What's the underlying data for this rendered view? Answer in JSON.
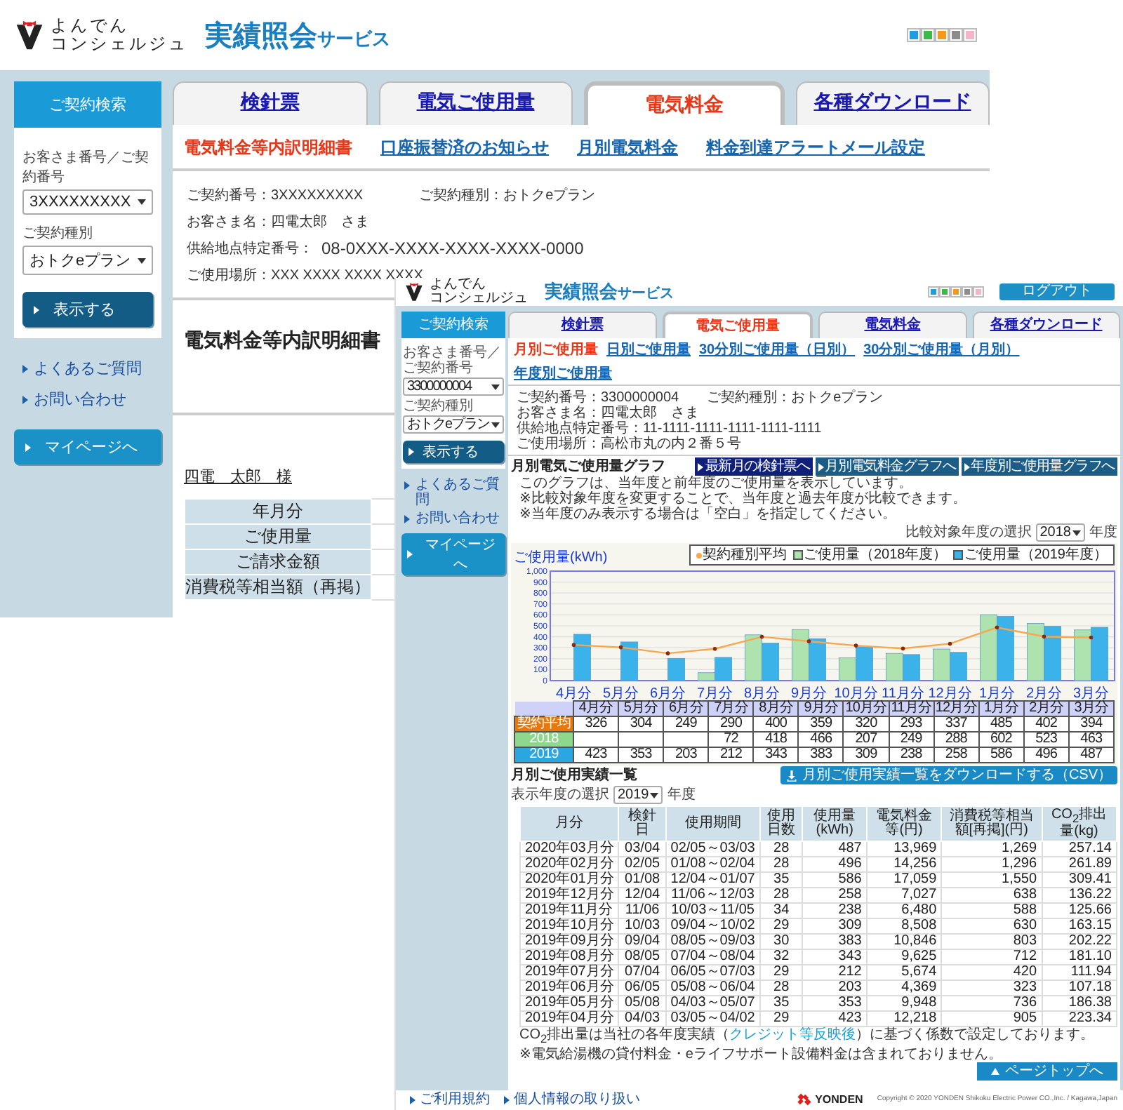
{
  "back_window": {
    "header": {
      "logo_text": [
        "よんでん",
        "コンシェルジュ"
      ],
      "title": "実績照会",
      "title_suffix": "サービス",
      "theme_swatches": [
        {
          "color": "#1e9ee0"
        },
        {
          "color": "#3cb94a"
        },
        {
          "color": "#f39a1e"
        },
        {
          "color": "#8c8c8c"
        },
        {
          "color": "#f5b5c8"
        }
      ]
    },
    "sidebar": {
      "heading": "ご契約検索",
      "fields": [
        {
          "label": "お客さま番号／ご契約番号",
          "value": "3XXXXXXXXX"
        },
        {
          "label": "ご契約種別",
          "value": "おトクeプラン"
        }
      ],
      "submit": "表示する",
      "links": [
        "よくあるご質問",
        "お問い合わせ"
      ],
      "mypage": "マイページへ"
    },
    "tabs": [
      {
        "label": "検針票",
        "selected": false
      },
      {
        "label": "電気ご使用量",
        "selected": false
      },
      {
        "label": "電気料金",
        "selected": true
      },
      {
        "label": "各種ダウンロード",
        "selected": false
      }
    ],
    "subtabs": [
      {
        "label": "電気料金等内訳明細書",
        "selected": true
      },
      {
        "label": "口座振替済のお知らせ",
        "selected": false
      },
      {
        "label": "月別電気料金",
        "selected": false
      },
      {
        "label": "料金到達アラートメール設定",
        "selected": false
      }
    ],
    "contract_info": [
      [
        "ご契約番号：3XXXXXXXXX",
        "ご契約種別：おトクeプラン"
      ],
      [
        "お客さま名：四電太郎　さま"
      ],
      [
        "供給地点特定番号：",
        "08-0XXX-XXXX-XXXX-XXXX-0000"
      ],
      [
        "ご使用場所：XXX XXXX XXXX XXXX"
      ]
    ],
    "page_title": "電気料金等内訳明細書",
    "customer_name": "四電　太郎　様",
    "summary_table": [
      "年月分",
      "ご使用量",
      "ご請求金額",
      "消費税等相当額（再掲）"
    ]
  },
  "front_window": {
    "header": {
      "logo_text": [
        "よんでん",
        "コンシェルジュ"
      ],
      "title": "実績照会",
      "title_suffix": "サービス",
      "theme_swatches": [
        {
          "color": "#1e9ee0"
        },
        {
          "color": "#3cb94a"
        },
        {
          "color": "#f39a1e"
        },
        {
          "color": "#8c8c8c"
        },
        {
          "color": "#f5b5c8"
        }
      ],
      "logout": "ログアウト"
    },
    "sidebar": {
      "heading": "ご契約検索",
      "fields": [
        {
          "label": "お客さま番号／ご契約番号",
          "value": "3300000004"
        },
        {
          "label": "ご契約種別",
          "value": "おトクeプラン"
        }
      ],
      "submit": "表示する",
      "links": [
        "よくあるご質問",
        "お問い合わせ"
      ],
      "mypage": "マイページへ"
    },
    "tabs": [
      {
        "label": "検針票",
        "selected": false
      },
      {
        "label": "電気ご使用量",
        "selected": true
      },
      {
        "label": "電気料金",
        "selected": false
      },
      {
        "label": "各種ダウンロード",
        "selected": false
      }
    ],
    "subtabs": [
      {
        "label": "月別ご使用量",
        "selected": true
      },
      {
        "label": "日別ご使用量",
        "selected": false
      },
      {
        "label": "30分別ご使用量（日別）",
        "selected": false
      },
      {
        "label": "30分別ご使用量（月別）",
        "selected": false
      },
      {
        "label": "年度別ご使用量",
        "selected": false
      }
    ],
    "contract_info": [
      [
        "ご契約番号：3300000004",
        "ご契約種別：おトクeプラン"
      ],
      [
        "お客さま名：四電太郎　さま"
      ],
      [
        "供給地点特定番号：11-1111-1111-1111-1111-1111"
      ],
      [
        "ご使用場所：高松市丸の内２番５号"
      ]
    ],
    "graph": {
      "title": "月別電気ご使用量グラフ",
      "buttons": [
        "最新月の検針票へ",
        "月別電気料金グラフへ",
        "年度別ご使用量グラフへ"
      ],
      "notes": [
        "このグラフは、当年度と前年度のご使用量を表示しています。",
        "※比較対象年度を変更することで、当年度と過去年度が比較できます。",
        "※当年度のみ表示する場合は「空白」を指定してください。"
      ],
      "compare_select": {
        "label": "比較対象年度の選択",
        "value": "2018",
        "suffix": "年度"
      },
      "chart_data": {
        "type": "bar",
        "ylabel": "ご使用量(kWh)",
        "categories": [
          "4月分",
          "5月分",
          "6月分",
          "7月分",
          "8月分",
          "9月分",
          "10月分",
          "11月分",
          "12月分",
          "1月分",
          "2月分",
          "3月分"
        ],
        "ylim": [
          0,
          1000
        ],
        "stacked": false,
        "grid": true,
        "legend": true,
        "yticks": [
          0,
          100,
          200,
          300,
          400,
          500,
          600,
          700,
          800,
          900,
          {
            "value": 1000,
            "label": "1,000"
          }
        ],
        "series": [
          {
            "name": "契約種別平均",
            "type": "line",
            "color": "#f5a850",
            "values": [
              326,
              304,
              249,
              290,
              400,
              359,
              320,
              293,
              337,
              485,
              402,
              394
            ]
          },
          {
            "name": "ご使用量（2018年度）",
            "type": "bar",
            "color": "#aee3b0",
            "values": [
              null,
              null,
              null,
              72,
              418,
              466,
              207,
              249,
              288,
              602,
              523,
              463
            ]
          },
          {
            "name": "ご使用量（2019年度）",
            "type": "bar",
            "color": "#3bb3ea",
            "values": [
              423,
              353,
              203,
              212,
              343,
              383,
              309,
              238,
              258,
              586,
              496,
              487
            ]
          }
        ]
      },
      "chart_table": {
        "columns": [
          "4月分",
          "5月分",
          "6月分",
          "7月分",
          "8月分",
          "9月分",
          "10月分",
          "11月分",
          "12月分",
          "1月分",
          "2月分",
          "3月分"
        ],
        "rows": [
          {
            "label": "契約平均",
            "color": "#e8780c",
            "cells": [
              "326",
              "304",
              "249",
              "290",
              "400",
              "359",
              "320",
              "293",
              "337",
              "485",
              "402",
              "394"
            ]
          },
          {
            "label": "2018",
            "color": "#8ed88e",
            "cells": [
              null,
              null,
              null,
              "72",
              "418",
              "466",
              "207",
              "249",
              "288",
              "602",
              "523",
              "463"
            ]
          },
          {
            "label": "2019",
            "color": "#2aa6e0",
            "cells": [
              "423",
              "353",
              "203",
              "212",
              "343",
              "383",
              "309",
              "238",
              "258",
              "586",
              "496",
              "487"
            ]
          }
        ]
      }
    },
    "history": {
      "download_button": "月別ご使用実績一覧をダウンロードする（CSV）",
      "title": "月別ご使用実績一覧",
      "year_select": {
        "label": "表示年度の選択",
        "value": "2019",
        "suffix": "年度"
      },
      "columns": [
        "月分",
        "検針日",
        "使用期間",
        "使用日数",
        "使用量(kWh)",
        "電気料金等(円)",
        "消費税等相当額[再掲](円)",
        "CO$_{2}$排出量(kg)"
      ],
      "rows": [
        [
          "2020年03月分",
          "03/04",
          "02/05～03/03",
          "28",
          "487",
          "13,969",
          "1,269",
          "257.14"
        ],
        [
          "2020年02月分",
          "02/05",
          "01/08～02/04",
          "28",
          "496",
          "14,256",
          "1,296",
          "261.89"
        ],
        [
          "2020年01月分",
          "01/08",
          "12/04～01/07",
          "35",
          "586",
          "17,059",
          "1,550",
          "309.41"
        ],
        [
          "2019年12月分",
          "12/04",
          "11/06～12/03",
          "28",
          "258",
          "7,027",
          "638",
          "136.22"
        ],
        [
          "2019年11月分",
          "11/06",
          "10/03～11/05",
          "34",
          "238",
          "6,480",
          "588",
          "125.66"
        ],
        [
          "2019年10月分",
          "10/03",
          "09/04～10/02",
          "29",
          "309",
          "8,508",
          "630",
          "163.15"
        ],
        [
          "2019年09月分",
          "09/04",
          "08/05～09/03",
          "30",
          "383",
          "10,846",
          "803",
          "202.22"
        ],
        [
          "2019年08月分",
          "08/05",
          "07/04～08/04",
          "32",
          "343",
          "9,625",
          "712",
          "181.10"
        ],
        [
          "2019年07月分",
          "07/04",
          "06/05～07/03",
          "29",
          "212",
          "5,674",
          "420",
          "111.94"
        ],
        [
          "2019年06月分",
          "06/05",
          "05/08～06/04",
          "28",
          "203",
          "4,369",
          "323",
          "107.18"
        ],
        [
          "2019年05月分",
          "05/08",
          "04/03～05/07",
          "35",
          "353",
          "9,948",
          "736",
          "186.38"
        ],
        [
          "2019年04月分",
          "04/03",
          "03/05～04/02",
          "29",
          "423",
          "12,218",
          "905",
          "223.34"
        ]
      ],
      "notes": [
        [
          {
            "text": "CO$_{2}$排出量は当社の各年度実績（"
          },
          {
            "link": "クレジット等反映後"
          },
          {
            "text": "）に基づく係数で設定しております。"
          }
        ],
        [
          {
            "text": "※電気給湯機の貸付料金・eライフサポート設備料金は含まれておりません。"
          }
        ]
      ]
    },
    "page_top_button": "ページトップへ",
    "footer": {
      "links": [
        "ご利用規約",
        "個人情報の取り扱い"
      ],
      "company": "YONDEN",
      "copyright": "Copyright © 2020 YONDEN Shikoku Electric Power CO.,Inc. / Kagawa,Japan"
    }
  }
}
